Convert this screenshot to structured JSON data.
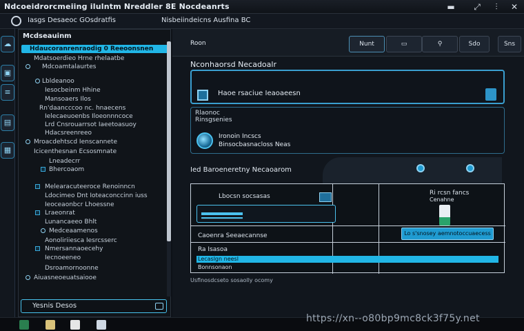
{
  "window": {
    "title": "Ndcoeidrorcmeiing ilulntm Nreddler 8E Nocdeanrts",
    "minimize_glyph": "▬",
    "restore_glyph": "⤢",
    "menu_glyph": "⫶",
    "close_glyph": "✕"
  },
  "header": {
    "left_text": "Iasgs Desaeoc GOsdratfis",
    "center_text": "Nisbeiindeicns Ausfina BC"
  },
  "tree": {
    "heading": "Mcdseauinm",
    "selected_label": "Hdaucoranrenraodig 0 Reeoonsnen",
    "rows": [
      "Mdatsoerdieo Hrne rhelaatbe",
      "Mdcoamtalaurtes",
      "Lbldeanoo",
      "Iesocbeinm Hhine",
      "Mansoaers Ilos",
      "Rn'daancccoo nc. hnaecens",
      "Ielecaeuoenbs Iloeonnncoce",
      "Lrd Cnsrouarrsot Iaeetoasuoy",
      "Hdacsreenreeo",
      "Mroacdehtscd Ienscannete",
      "Icicenthesnan Ecsosmnate",
      "Lneadecrr",
      "Bhercoaom",
      "Melearacuteeroce Renoinncn",
      "Ldocimeo Dnt Ioteaconccinn iuss",
      "Ieoceaonbcr Lhoessne",
      "Lraeonrat",
      "Lunancaeeo Bhlt",
      "Medceaamenos",
      "Aonoliriiesca Iesrcsserc",
      "Nmersannaoecehy",
      "Iecnoeeneo",
      "Dsroamornoonne",
      "Aiuasneoeuatsaiooe"
    ],
    "footer_label": "Yesnis Desos"
  },
  "toolbar": {
    "label": "Roon",
    "buttons": [
      "Nunt",
      "▭",
      "⚲",
      "Sdo",
      "Sns"
    ]
  },
  "main": {
    "section_title": "Nconhaorsd Necadoalr",
    "card1_text": "Haoe rsaciue Ieaoaeesn",
    "card2_line1": "Rlaonoc",
    "card2_line2": "Rinsgsenies",
    "card2_line3": "Ironoin Incscs",
    "card2_line4": "Binsocbasnacloss  Neas",
    "section2_title": "Ied Baroeneretny Necaoarom",
    "grid": {
      "top_label": "Lbocsn socsasas",
      "row2": "Caoenra Seeaecannse",
      "row3": "Ra Isasoa",
      "blue_row": "Lecaslgn neesl",
      "row4": "Bonnsonaon",
      "right_label": "Ri rcsn fancs",
      "right_sub": "Cenahne",
      "action_label": "Lo s'snosey aemnotoccuaecess"
    },
    "footnote": "Usflnosdcseto sosaolly ocomy"
  },
  "watermark": "https://xn--o80bp9mc8ck3f75y.net"
}
